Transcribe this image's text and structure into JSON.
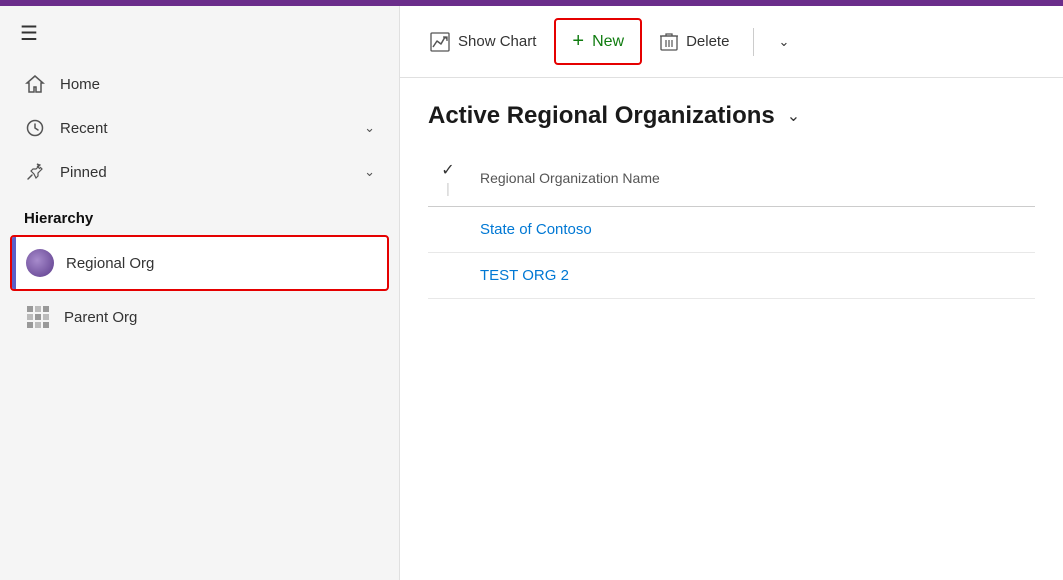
{
  "topbar": {},
  "sidebar": {
    "nav_items": [
      {
        "id": "home",
        "icon": "⌂",
        "label": "Home",
        "has_chevron": false
      },
      {
        "id": "recent",
        "icon": "⊙",
        "label": "Recent",
        "has_chevron": true
      },
      {
        "id": "pinned",
        "icon": "📌",
        "label": "Pinned",
        "has_chevron": true
      }
    ],
    "hierarchy_label": "Hierarchy",
    "hierarchy_items": [
      {
        "id": "regional-org",
        "label": "Regional Org",
        "type": "sphere",
        "active": true
      },
      {
        "id": "parent-org",
        "label": "Parent Org",
        "type": "grid",
        "active": false
      }
    ]
  },
  "toolbar": {
    "show_chart_label": "Show Chart",
    "new_label": "New",
    "delete_label": "Delete"
  },
  "main": {
    "view_title": "Active Regional Organizations",
    "table": {
      "column_header": "Regional Organization Name",
      "rows": [
        {
          "id": "row1",
          "name": "State of Contoso"
        },
        {
          "id": "row2",
          "name": "TEST ORG 2"
        }
      ]
    }
  },
  "icons": {
    "hamburger": "≡",
    "home": "⌂",
    "recent": "🕐",
    "pinned": "📌",
    "chevron_down": "∨",
    "chart": "📈",
    "plus": "+",
    "trash": "🗑",
    "check": "✓"
  }
}
